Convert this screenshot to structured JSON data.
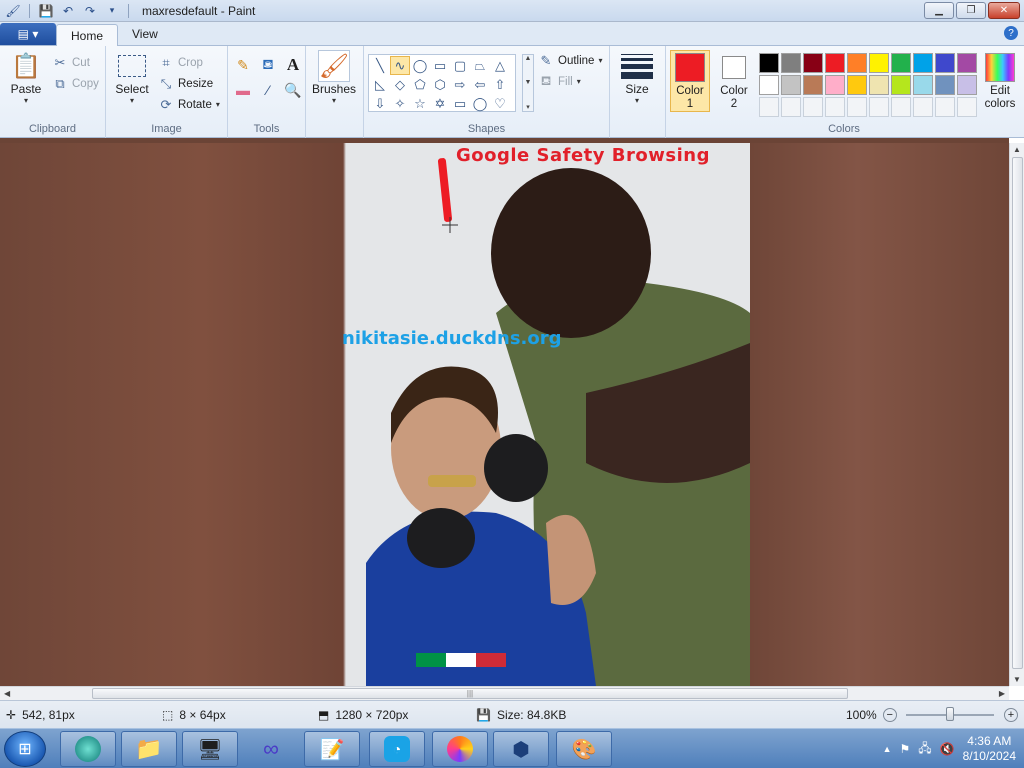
{
  "window": {
    "title": "maxresdefault - Paint"
  },
  "tabs": [
    {
      "label": "Home",
      "active": true
    },
    {
      "label": "View",
      "active": false
    }
  ],
  "ribbon": {
    "clipboard": {
      "label": "Clipboard",
      "paste": "Paste",
      "cut": "Cut",
      "copy": "Copy"
    },
    "image": {
      "label": "Image",
      "select": "Select",
      "crop": "Crop",
      "resize": "Resize",
      "rotate": "Rotate"
    },
    "tools": {
      "label": "Tools"
    },
    "brushes": {
      "label": "Brushes"
    },
    "shapes": {
      "label": "Shapes",
      "outline": "Outline",
      "fill": "Fill"
    },
    "size": {
      "label": "Size"
    },
    "colors": {
      "label": "Colors",
      "color1": "Color\n1",
      "color1_line1": "Color",
      "color1_line2": "1",
      "color2_line1": "Color",
      "color2_line2": "2",
      "color1_value": "#ed1c24",
      "color2_value": "#ffffff",
      "edit_line1": "Edit",
      "edit_line2": "colors",
      "palette_row1": [
        "#000000",
        "#7f7f7f",
        "#880015",
        "#ed1c24",
        "#ff7f27",
        "#fff200",
        "#22b14c",
        "#00a2e8",
        "#3f48cc",
        "#a349a4"
      ],
      "palette_row2": [
        "#ffffff",
        "#c3c3c3",
        "#b97a57",
        "#ffaec9",
        "#ffc90e",
        "#efe4b0",
        "#b5e61d",
        "#99d9ea",
        "#7092be",
        "#c8bfe7"
      ]
    }
  },
  "canvas": {
    "overlay_top": "Google Safety Browsing",
    "overlay_mid": "nikitasie.duckdns.org"
  },
  "status": {
    "cursor_pos": "542, 81px",
    "selection_size": "8 × 64px",
    "image_size": "1280 × 720px",
    "file_size": "Size: 84.8KB",
    "zoom": "100%"
  },
  "taskbar": {
    "time": "4:36 AM",
    "date": "8/10/2024"
  }
}
